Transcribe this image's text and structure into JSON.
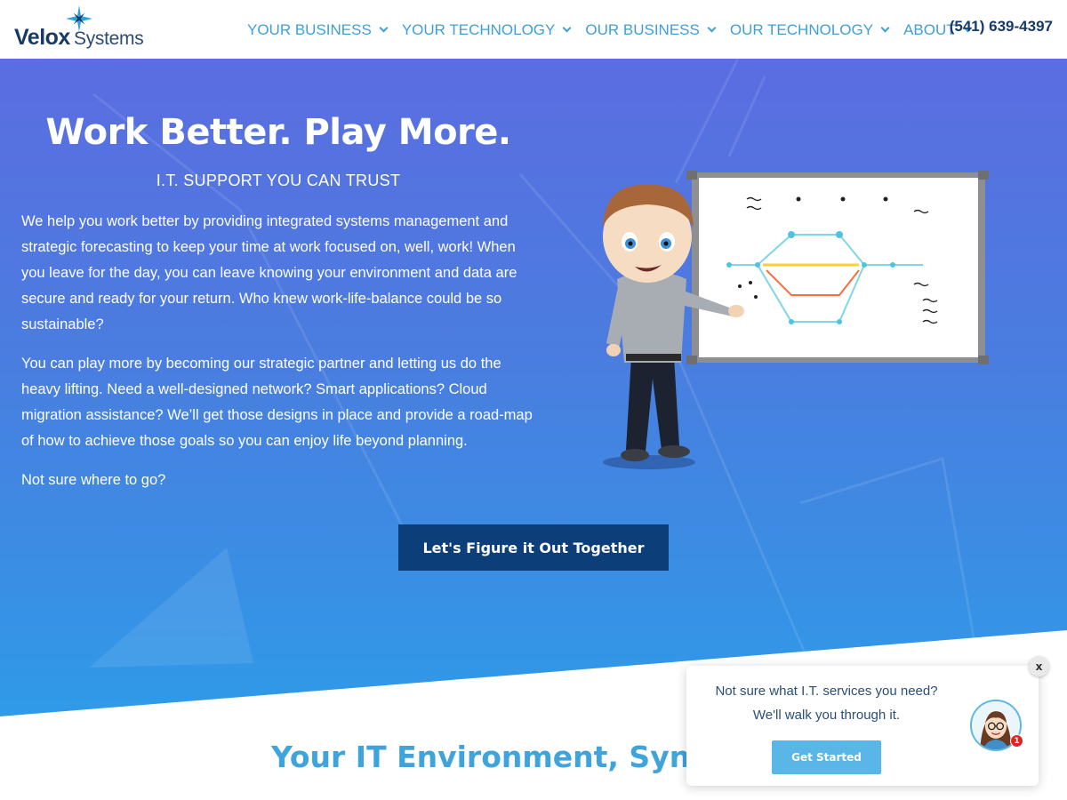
{
  "brand": {
    "logo_primary": "Velox",
    "logo_secondary": "Systems",
    "phone": "(541) 639-4397",
    "colors": {
      "navy": "#173a66",
      "nav_blue": "#3f9fd6",
      "cta_navy": "#0c3f7a",
      "hero_top": "#5b6de1",
      "hero_bottom": "#2f9ae8",
      "section_title": "#3fa3dc"
    }
  },
  "nav": {
    "items": [
      {
        "label": "YOUR BUSINESS",
        "icon": "chevron-down-icon"
      },
      {
        "label": "YOUR TECHNOLOGY",
        "icon": "chevron-down-icon"
      },
      {
        "label": "OUR BUSINESS",
        "icon": "chevron-down-icon"
      },
      {
        "label": "OUR TECHNOLOGY",
        "icon": "chevron-down-icon"
      },
      {
        "label": "ABOUT",
        "icon": "chevron-down-icon"
      }
    ]
  },
  "hero": {
    "title": "Work Better. Play More.",
    "subtitle": "I.T. SUPPORT YOU CAN TRUST",
    "paragraphs": [
      "We help you work better by providing integrated systems management and strategic forecasting to keep your time at work focused on, well, work! When you leave for the day, you can leave knowing your environment and data are secure and ready for your return. Who knew work-life-balance could be so sustainable?",
      "You can play more by becoming our strategic partner and letting us do the heavy lifting. Need a well-designed network? Smart applications? Cloud migration assistance? We’ll get those designs in place and provide a road-map of how to achieve those goals so you can enjoy life beyond planning.",
      "Not sure where to go?"
    ],
    "cta_label": "Let's Figure it Out Together",
    "illustration": "cartoon-presenter-whiteboard"
  },
  "section": {
    "title": "Your IT Environment, Synchr"
  },
  "chat": {
    "question": "Not sure what I.T. services you need?",
    "subtext": "We'll walk you through it.",
    "button_label": "Get Started",
    "badge_count": "1",
    "close_label": "x"
  }
}
